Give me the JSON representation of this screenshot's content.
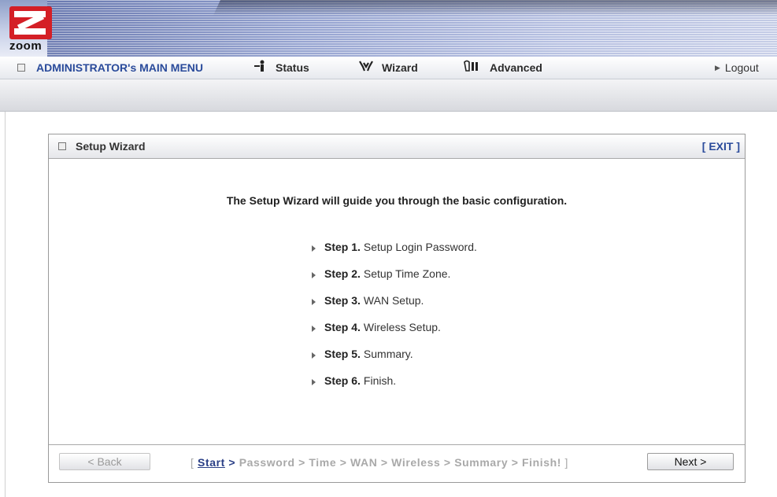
{
  "brand": {
    "logo_text": "zoom"
  },
  "menu": {
    "main_label": "ADMINISTRATOR's MAIN MENU",
    "status_label": "Status",
    "wizard_label": "Wizard",
    "advanced_label": "Advanced",
    "logout_label": "Logout",
    "status_icon": "person-icon",
    "wizard_icon": "wizard-hands-icon",
    "advanced_icon": "advanced-settings-icon"
  },
  "panel": {
    "title": "Setup Wizard",
    "exit_label": "[ EXIT ]",
    "intro": "The Setup Wizard will guide you through the basic configuration."
  },
  "steps": [
    {
      "num": "Step 1.",
      "text": "Setup Login Password."
    },
    {
      "num": "Step 2.",
      "text": "Setup Time Zone."
    },
    {
      "num": "Step 3.",
      "text": "WAN Setup."
    },
    {
      "num": "Step 4.",
      "text": "Wireless Setup."
    },
    {
      "num": "Step 5.",
      "text": "Summary."
    },
    {
      "num": "Step 6.",
      "text": "Finish."
    }
  ],
  "footer": {
    "back_label": "< Back",
    "next_label": "Next >",
    "crumb_open": "[",
    "crumb_current": "Start",
    "crumb_current_sep": ">",
    "crumb_rest": "Password > Time > WAN > Wireless > Summary > Finish!",
    "crumb_close": "]"
  },
  "colors": {
    "link_blue": "#2a4b9b",
    "logo_red": "#d41f26",
    "crumb_inactive": "#a9a9a9"
  }
}
